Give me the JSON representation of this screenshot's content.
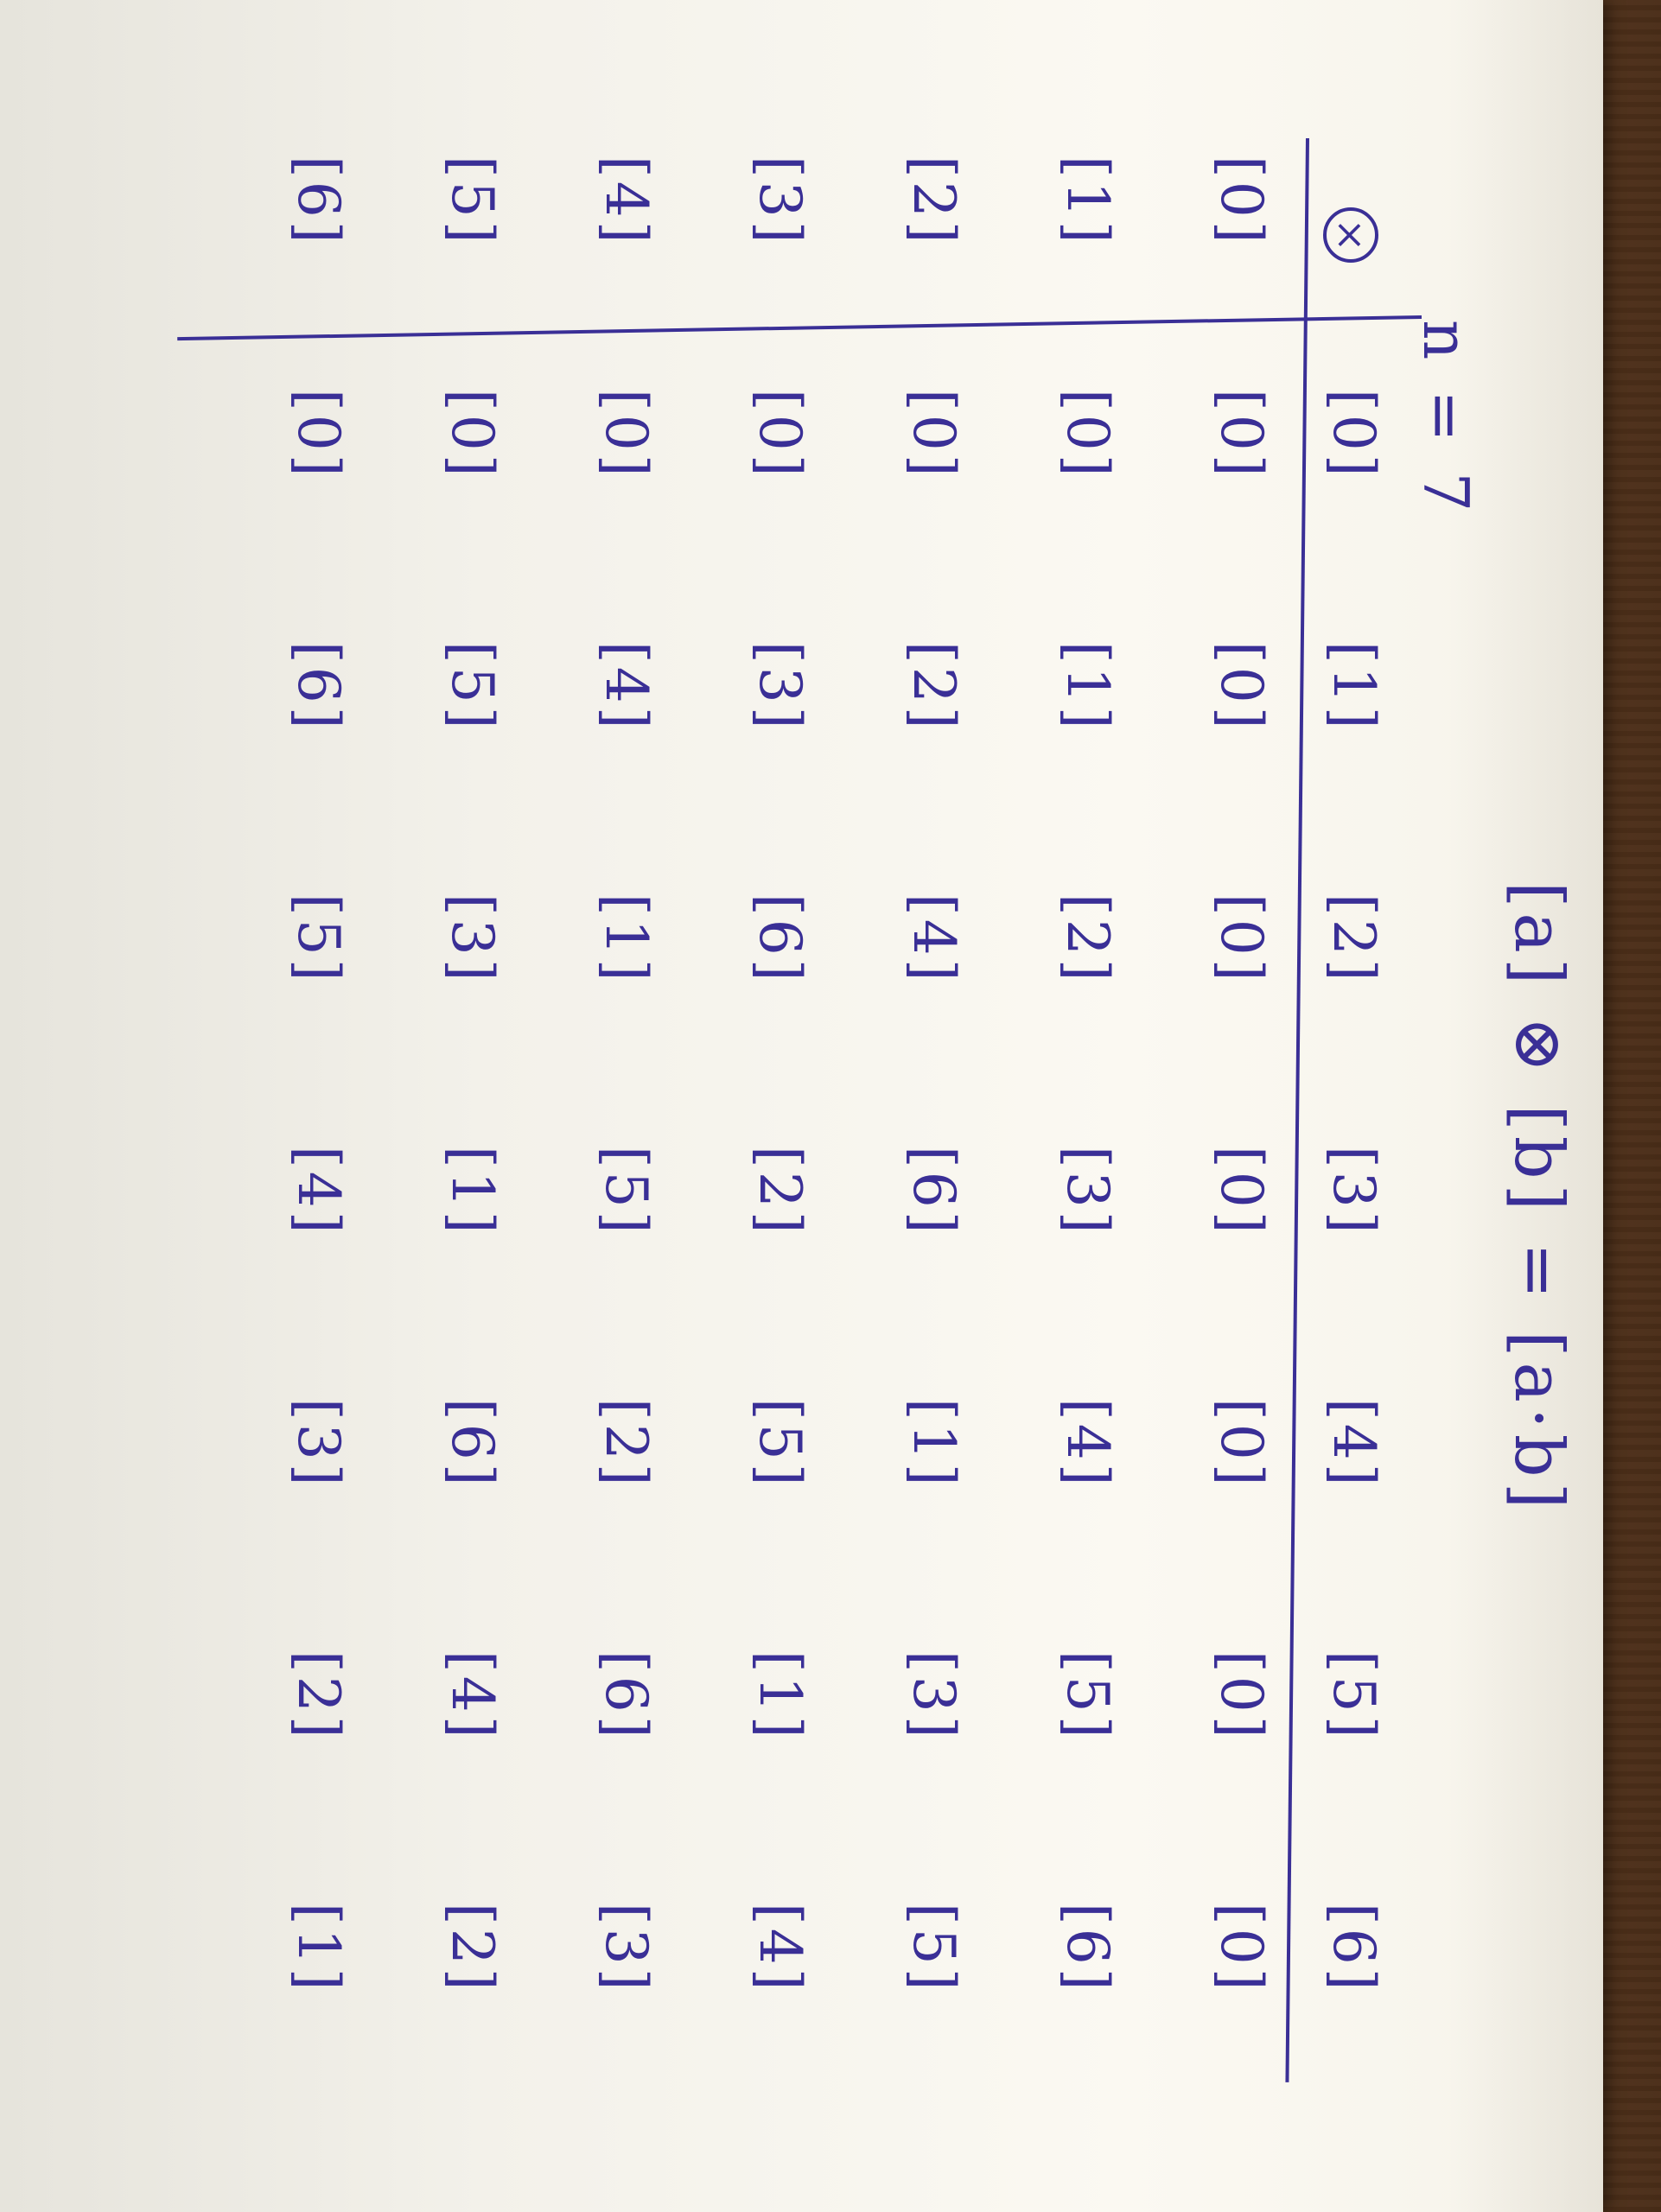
{
  "equation": "[a] ⊗ [b] = [a·b]",
  "modulus": "n = 7",
  "operator_symbol": "×",
  "column_headers": [
    "[0]",
    "[1]",
    "[2]",
    "[3]",
    "[4]",
    "[5]",
    "[6]"
  ],
  "row_headers": [
    "[0]",
    "[1]",
    "[2]",
    "[3]",
    "[4]",
    "[5]",
    "[6]"
  ],
  "table": [
    [
      "[0]",
      "[0]",
      "[0]",
      "[0]",
      "[0]",
      "[0]",
      "[0]"
    ],
    [
      "[0]",
      "[1]",
      "[2]",
      "[3]",
      "[4]",
      "[5]",
      "[6]"
    ],
    [
      "[0]",
      "[2]",
      "[4]",
      "[6]",
      "[1]",
      "[3]",
      "[5]"
    ],
    [
      "[0]",
      "[3]",
      "[6]",
      "[2]",
      "[5]",
      "[1]",
      "[4]"
    ],
    [
      "[0]",
      "[4]",
      "[1]",
      "[5]",
      "[2]",
      "[6]",
      "[3]"
    ],
    [
      "[0]",
      "[5]",
      "[3]",
      "[1]",
      "[6]",
      "[4]",
      "[2]"
    ],
    [
      "[0]",
      "[6]",
      "[5]",
      "[4]",
      "[3]",
      "[2]",
      "[1]"
    ]
  ],
  "colors": {
    "ink": "#3a2f96",
    "paper": "#f6f3ea",
    "desk": "#6e4526"
  }
}
